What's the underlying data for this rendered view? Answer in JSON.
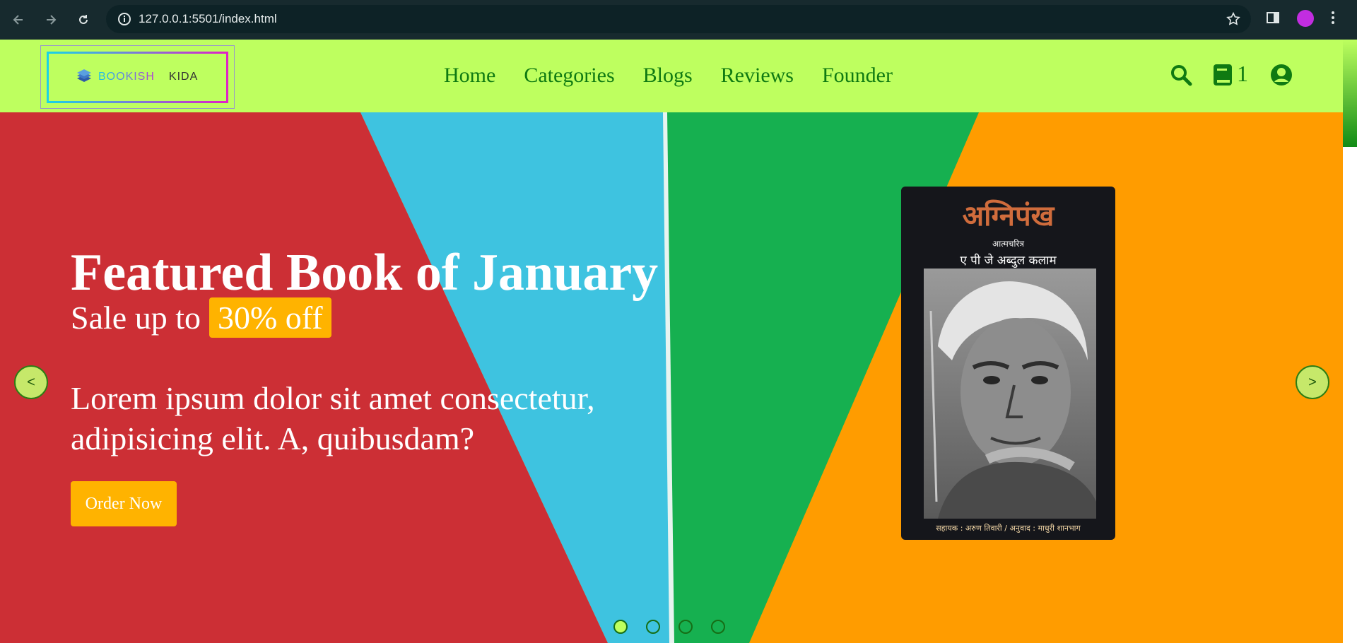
{
  "browser": {
    "url": "127.0.0.1:5501/index.html"
  },
  "header": {
    "logo": {
      "brand_first": "BOOKISH",
      "brand_second": "KIDA",
      "icon": "book-stack-icon"
    },
    "menu": [
      {
        "label": "Home"
      },
      {
        "label": "Categories"
      },
      {
        "label": "Blogs"
      },
      {
        "label": "Reviews"
      },
      {
        "label": "Founder"
      }
    ],
    "cart_count": "1",
    "icons": {
      "search": "search-icon",
      "cart": "book-icon",
      "user": "user-circle-icon"
    },
    "accent": "#beff5f",
    "link_color": "#0f7a12"
  },
  "hero": {
    "title": "Featured Book of January",
    "sale_prefix": "Sale up to",
    "sale_badge": "30% off",
    "description": "Lorem ipsum dolor sit amet consectetur, adipisicing elit. A, quibusdam?",
    "button": "Order Now",
    "prev_label": "<",
    "next_label": ">",
    "slide_count": 4,
    "active_slide": 1,
    "button_color": "#ffb300"
  },
  "book": {
    "title": "अग्निपंख",
    "subtitle": "आत्मचरित्र",
    "author": "ए पी जे अब्दुल कलाम",
    "credit": "सहायक : अरुण तिवारी / अनुवाद : माधुरी शानभाग"
  }
}
